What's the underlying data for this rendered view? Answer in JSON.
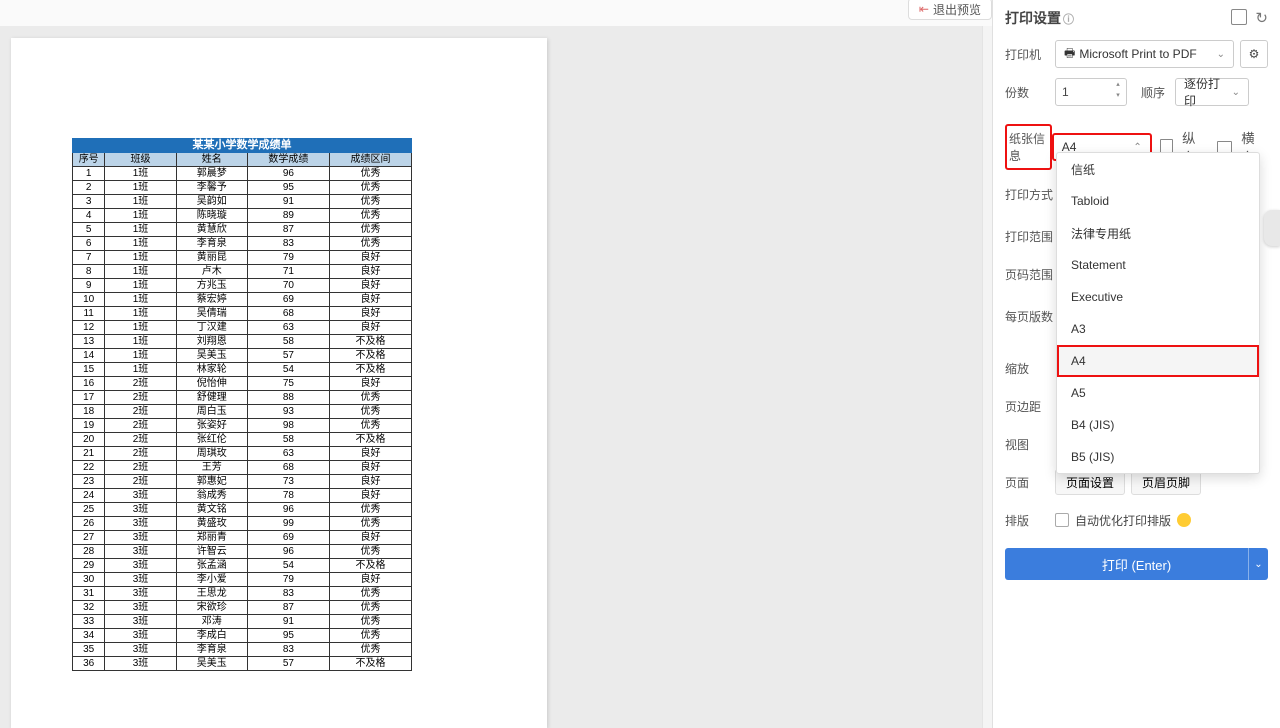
{
  "topbar": {
    "exit_label": "退出预览"
  },
  "panel": {
    "title": "打印设置",
    "printer_label": "打印机",
    "printer_value": "Microsoft Print to PDF",
    "copies_label": "份数",
    "copies_value": "1",
    "order_label": "顺序",
    "order_value": "逐份打印",
    "paper_label": "纸张信息",
    "paper_value": "A4",
    "portrait": "纵向",
    "landscape": "横向",
    "print_mode": "打印方式",
    "print_range": "打印范围",
    "page_range": "页码范围",
    "per_page": "每页版数",
    "scale": "缩放",
    "margin": "页边距",
    "view": "视图",
    "page": "页面",
    "page_setup": "页面设置",
    "header_footer": "页眉页脚",
    "layout": "排版",
    "auto_layout": "自动优化打印排版",
    "print_btn": "打印 (Enter)"
  },
  "paper_options": [
    "信纸",
    "Tabloid",
    "法律专用纸",
    "Statement",
    "Executive",
    "A3",
    "A4",
    "A5",
    "B4 (JIS)",
    "B5 (JIS)"
  ],
  "paper_selected_index": 6,
  "sheet": {
    "title": "某某小学数学成绩单",
    "headers": [
      "序号",
      "班级",
      "姓名",
      "数学成绩",
      "成绩区间"
    ],
    "rows": [
      [
        "1",
        "1班",
        "郭晨梦",
        "96",
        "优秀"
      ],
      [
        "2",
        "1班",
        "李馨予",
        "95",
        "优秀"
      ],
      [
        "3",
        "1班",
        "吴韵如",
        "91",
        "优秀"
      ],
      [
        "4",
        "1班",
        "陈晓璇",
        "89",
        "优秀"
      ],
      [
        "5",
        "1班",
        "黄慧欣",
        "87",
        "优秀"
      ],
      [
        "6",
        "1班",
        "李育泉",
        "83",
        "优秀"
      ],
      [
        "7",
        "1班",
        "黄丽昆",
        "79",
        "良好"
      ],
      [
        "8",
        "1班",
        "卢木",
        "71",
        "良好"
      ],
      [
        "9",
        "1班",
        "方兆玉",
        "70",
        "良好"
      ],
      [
        "10",
        "1班",
        "蔡宏婷",
        "69",
        "良好"
      ],
      [
        "11",
        "1班",
        "吴倩瑞",
        "68",
        "良好"
      ],
      [
        "12",
        "1班",
        "丁汉建",
        "63",
        "良好"
      ],
      [
        "13",
        "1班",
        "刘翔恩",
        "58",
        "不及格"
      ],
      [
        "14",
        "1班",
        "吴美玉",
        "57",
        "不及格"
      ],
      [
        "15",
        "1班",
        "林家轮",
        "54",
        "不及格"
      ],
      [
        "16",
        "2班",
        "倪怡伸",
        "75",
        "良好"
      ],
      [
        "17",
        "2班",
        "舒健理",
        "88",
        "优秀"
      ],
      [
        "18",
        "2班",
        "周白玉",
        "93",
        "优秀"
      ],
      [
        "19",
        "2班",
        "张姿好",
        "98",
        "优秀"
      ],
      [
        "20",
        "2班",
        "张红伦",
        "58",
        "不及格"
      ],
      [
        "21",
        "2班",
        "周琪玫",
        "63",
        "良好"
      ],
      [
        "22",
        "2班",
        "王芳",
        "68",
        "良好"
      ],
      [
        "23",
        "2班",
        "郭惠妃",
        "73",
        "良好"
      ],
      [
        "24",
        "3班",
        "翁成秀",
        "78",
        "良好"
      ],
      [
        "25",
        "3班",
        "黄文铭",
        "96",
        "优秀"
      ],
      [
        "26",
        "3班",
        "黄盛玫",
        "99",
        "优秀"
      ],
      [
        "27",
        "3班",
        "郑丽青",
        "69",
        "良好"
      ],
      [
        "28",
        "3班",
        "许智云",
        "96",
        "优秀"
      ],
      [
        "29",
        "3班",
        "张孟涵",
        "54",
        "不及格"
      ],
      [
        "30",
        "3班",
        "李小爱",
        "79",
        "良好"
      ],
      [
        "31",
        "3班",
        "王思龙",
        "83",
        "优秀"
      ],
      [
        "32",
        "3班",
        "宋欲珍",
        "87",
        "优秀"
      ],
      [
        "33",
        "3班",
        "邓涛",
        "91",
        "优秀"
      ],
      [
        "34",
        "3班",
        "李成白",
        "95",
        "优秀"
      ],
      [
        "35",
        "3班",
        "李育泉",
        "83",
        "优秀"
      ],
      [
        "36",
        "3班",
        "吴美玉",
        "57",
        "不及格"
      ]
    ]
  }
}
